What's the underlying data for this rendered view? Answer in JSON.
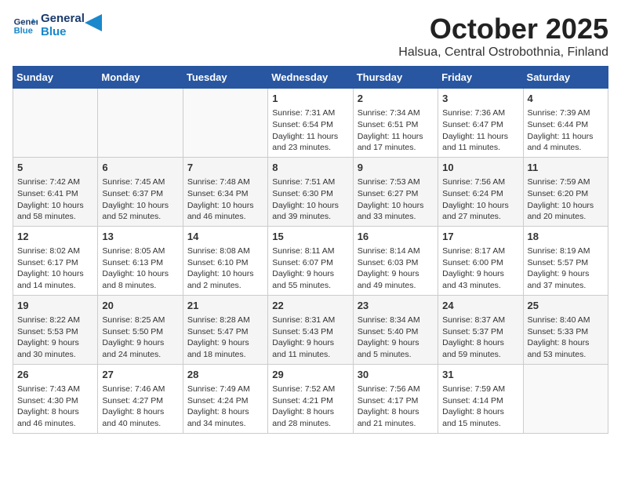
{
  "header": {
    "logo_line1": "General",
    "logo_line2": "Blue",
    "month": "October 2025",
    "location": "Halsua, Central Ostrobothnia, Finland"
  },
  "weekdays": [
    "Sunday",
    "Monday",
    "Tuesday",
    "Wednesday",
    "Thursday",
    "Friday",
    "Saturday"
  ],
  "weeks": [
    [
      {
        "day": "",
        "info": ""
      },
      {
        "day": "",
        "info": ""
      },
      {
        "day": "",
        "info": ""
      },
      {
        "day": "1",
        "info": "Sunrise: 7:31 AM\nSunset: 6:54 PM\nDaylight: 11 hours and 23 minutes."
      },
      {
        "day": "2",
        "info": "Sunrise: 7:34 AM\nSunset: 6:51 PM\nDaylight: 11 hours and 17 minutes."
      },
      {
        "day": "3",
        "info": "Sunrise: 7:36 AM\nSunset: 6:47 PM\nDaylight: 11 hours and 11 minutes."
      },
      {
        "day": "4",
        "info": "Sunrise: 7:39 AM\nSunset: 6:44 PM\nDaylight: 11 hours and 4 minutes."
      }
    ],
    [
      {
        "day": "5",
        "info": "Sunrise: 7:42 AM\nSunset: 6:41 PM\nDaylight: 10 hours and 58 minutes."
      },
      {
        "day": "6",
        "info": "Sunrise: 7:45 AM\nSunset: 6:37 PM\nDaylight: 10 hours and 52 minutes."
      },
      {
        "day": "7",
        "info": "Sunrise: 7:48 AM\nSunset: 6:34 PM\nDaylight: 10 hours and 46 minutes."
      },
      {
        "day": "8",
        "info": "Sunrise: 7:51 AM\nSunset: 6:30 PM\nDaylight: 10 hours and 39 minutes."
      },
      {
        "day": "9",
        "info": "Sunrise: 7:53 AM\nSunset: 6:27 PM\nDaylight: 10 hours and 33 minutes."
      },
      {
        "day": "10",
        "info": "Sunrise: 7:56 AM\nSunset: 6:24 PM\nDaylight: 10 hours and 27 minutes."
      },
      {
        "day": "11",
        "info": "Sunrise: 7:59 AM\nSunset: 6:20 PM\nDaylight: 10 hours and 20 minutes."
      }
    ],
    [
      {
        "day": "12",
        "info": "Sunrise: 8:02 AM\nSunset: 6:17 PM\nDaylight: 10 hours and 14 minutes."
      },
      {
        "day": "13",
        "info": "Sunrise: 8:05 AM\nSunset: 6:13 PM\nDaylight: 10 hours and 8 minutes."
      },
      {
        "day": "14",
        "info": "Sunrise: 8:08 AM\nSunset: 6:10 PM\nDaylight: 10 hours and 2 minutes."
      },
      {
        "day": "15",
        "info": "Sunrise: 8:11 AM\nSunset: 6:07 PM\nDaylight: 9 hours and 55 minutes."
      },
      {
        "day": "16",
        "info": "Sunrise: 8:14 AM\nSunset: 6:03 PM\nDaylight: 9 hours and 49 minutes."
      },
      {
        "day": "17",
        "info": "Sunrise: 8:17 AM\nSunset: 6:00 PM\nDaylight: 9 hours and 43 minutes."
      },
      {
        "day": "18",
        "info": "Sunrise: 8:19 AM\nSunset: 5:57 PM\nDaylight: 9 hours and 37 minutes."
      }
    ],
    [
      {
        "day": "19",
        "info": "Sunrise: 8:22 AM\nSunset: 5:53 PM\nDaylight: 9 hours and 30 minutes."
      },
      {
        "day": "20",
        "info": "Sunrise: 8:25 AM\nSunset: 5:50 PM\nDaylight: 9 hours and 24 minutes."
      },
      {
        "day": "21",
        "info": "Sunrise: 8:28 AM\nSunset: 5:47 PM\nDaylight: 9 hours and 18 minutes."
      },
      {
        "day": "22",
        "info": "Sunrise: 8:31 AM\nSunset: 5:43 PM\nDaylight: 9 hours and 11 minutes."
      },
      {
        "day": "23",
        "info": "Sunrise: 8:34 AM\nSunset: 5:40 PM\nDaylight: 9 hours and 5 minutes."
      },
      {
        "day": "24",
        "info": "Sunrise: 8:37 AM\nSunset: 5:37 PM\nDaylight: 8 hours and 59 minutes."
      },
      {
        "day": "25",
        "info": "Sunrise: 8:40 AM\nSunset: 5:33 PM\nDaylight: 8 hours and 53 minutes."
      }
    ],
    [
      {
        "day": "26",
        "info": "Sunrise: 7:43 AM\nSunset: 4:30 PM\nDaylight: 8 hours and 46 minutes."
      },
      {
        "day": "27",
        "info": "Sunrise: 7:46 AM\nSunset: 4:27 PM\nDaylight: 8 hours and 40 minutes."
      },
      {
        "day": "28",
        "info": "Sunrise: 7:49 AM\nSunset: 4:24 PM\nDaylight: 8 hours and 34 minutes."
      },
      {
        "day": "29",
        "info": "Sunrise: 7:52 AM\nSunset: 4:21 PM\nDaylight: 8 hours and 28 minutes."
      },
      {
        "day": "30",
        "info": "Sunrise: 7:56 AM\nSunset: 4:17 PM\nDaylight: 8 hours and 21 minutes."
      },
      {
        "day": "31",
        "info": "Sunrise: 7:59 AM\nSunset: 4:14 PM\nDaylight: 8 hours and 15 minutes."
      },
      {
        "day": "",
        "info": ""
      }
    ]
  ]
}
